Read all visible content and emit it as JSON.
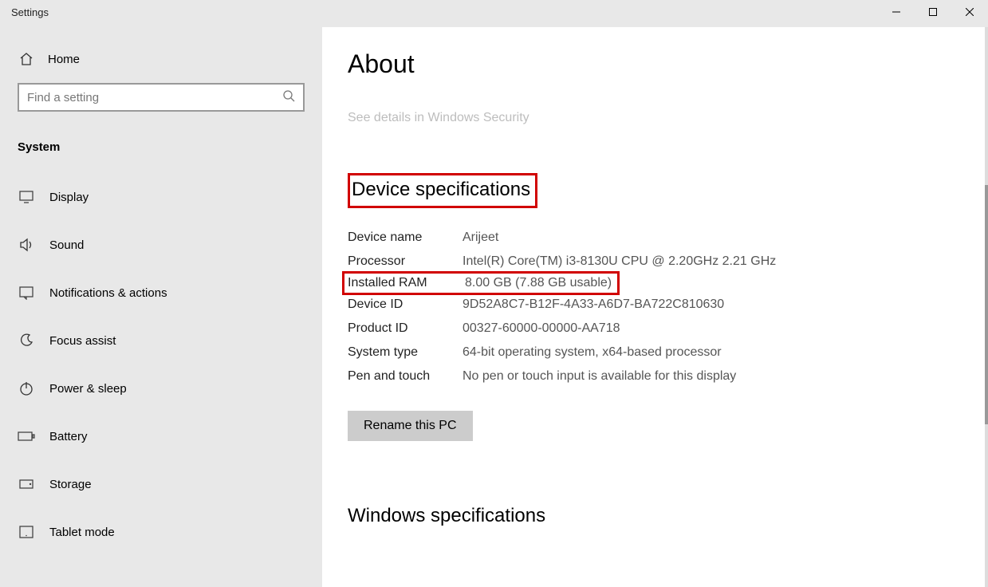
{
  "window": {
    "title": "Settings"
  },
  "sidebar": {
    "home": "Home",
    "search_placeholder": "Find a setting",
    "category": "System",
    "items": [
      {
        "label": "Display"
      },
      {
        "label": "Sound"
      },
      {
        "label": "Notifications & actions"
      },
      {
        "label": "Focus assist"
      },
      {
        "label": "Power & sleep"
      },
      {
        "label": "Battery"
      },
      {
        "label": "Storage"
      },
      {
        "label": "Tablet mode"
      }
    ]
  },
  "main": {
    "title": "About",
    "security_link": "See details in Windows Security",
    "device_spec_header": "Device specifications",
    "specs": [
      {
        "k": "Device name",
        "v": "Arijeet"
      },
      {
        "k": "Processor",
        "v": "Intel(R) Core(TM) i3-8130U CPU @ 2.20GHz   2.21 GHz"
      },
      {
        "k": "Installed RAM",
        "v": "8.00 GB (7.88 GB usable)"
      },
      {
        "k": "Device ID",
        "v": "9D52A8C7-B12F-4A33-A6D7-BA722C810630"
      },
      {
        "k": "Product ID",
        "v": "00327-60000-00000-AA718"
      },
      {
        "k": "System type",
        "v": "64-bit operating system, x64-based processor"
      },
      {
        "k": "Pen and touch",
        "v": "No pen or touch input is available for this display"
      }
    ],
    "rename_button": "Rename this PC",
    "windows_spec_header": "Windows specifications"
  }
}
